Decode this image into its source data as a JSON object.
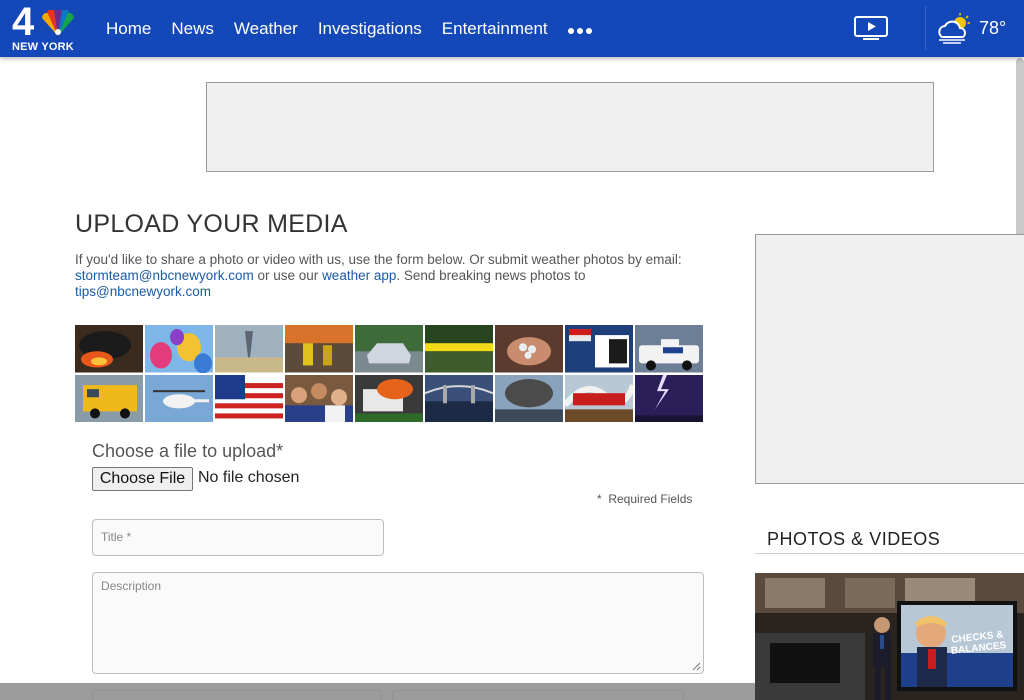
{
  "header": {
    "logo_number": "4",
    "logo_text": "NEW YORK",
    "nav": [
      "Home",
      "News",
      "Weather",
      "Investigations",
      "Entertainment"
    ],
    "more_icon": "more-dots-icon",
    "video_icon": "video-play-icon",
    "weather_icon": "partly-cloudy-icon",
    "temperature": "78°"
  },
  "colors": {
    "header_bg": "#1447b8",
    "link": "#1a5aa6",
    "ad_bg": "#f0f0f0"
  },
  "main": {
    "title": "UPLOAD YOUR MEDIA",
    "intro": {
      "text1": "If you'd like to share a photo or video with us, use the form below. Or submit weather photos by email: ",
      "email1": "stormteam@nbcnewyork.com",
      "text2": " or use our ",
      "app_link": "weather app",
      "text3": ". Send breaking news photos to ",
      "email2": "tips@nbcnewyork.com"
    },
    "mosaic_tiles": [
      "fire-smoke",
      "hot-air-balloons",
      "tornado-field",
      "firefighters",
      "flooded-car",
      "police-tape",
      "hail-in-hand",
      "gas-price-sign",
      "nypd-car",
      "school-bus",
      "helicopter",
      "american-flag",
      "crowd-fans",
      "burning-truck",
      "bridge-skyline",
      "smoke-cloud",
      "cyclone-coaster",
      "lightning"
    ],
    "upload": {
      "label": "Choose a file to upload*",
      "button": "Choose File",
      "status": "No file chosen",
      "required_note": "*  Required Fields"
    },
    "fields": {
      "title_placeholder": "Title *",
      "description_placeholder": "Description"
    }
  },
  "sidebar": {
    "heading": "PHOTOS & VIDEOS",
    "video_overlay": "CHECKS & BALANCES"
  }
}
